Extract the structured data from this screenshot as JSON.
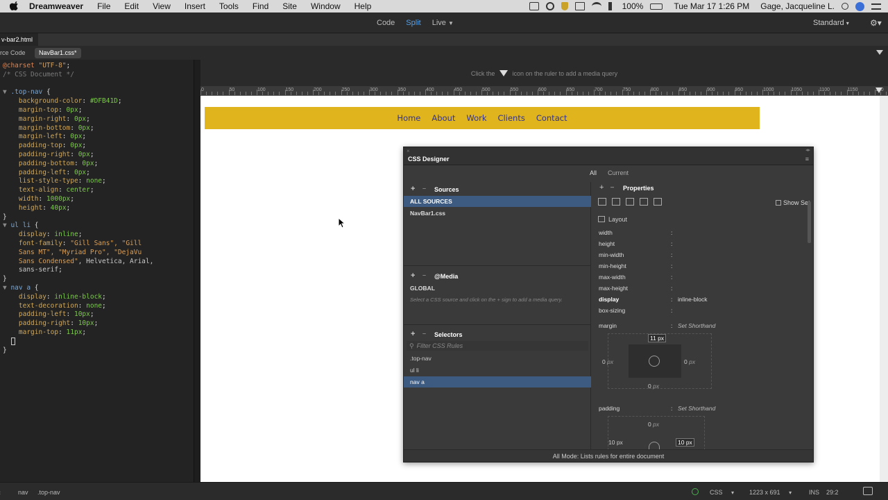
{
  "menubar": {
    "app": "Dreamweaver",
    "items": [
      "File",
      "Edit",
      "View",
      "Insert",
      "Tools",
      "Find",
      "Site",
      "Window",
      "Help"
    ],
    "battery": "100%",
    "clock": "Tue Mar 17  1:26 PM",
    "user": "Gage, Jacqueline L."
  },
  "toolbar": {
    "views": [
      "Code",
      "Split",
      "Live"
    ],
    "active_view": "Split",
    "workspace": "Standard"
  },
  "doc_tab": "v-bar2.html",
  "related_files": {
    "source": "rce Code",
    "css": "NavBar1.css*"
  },
  "code_lines": [
    [
      [
        "c-at",
        "@charset "
      ],
      [
        "c-str",
        "\"UTF-8\""
      ],
      [
        "c-plain",
        ";"
      ]
    ],
    [
      [
        "c-gray",
        "/* CSS Document */"
      ]
    ],
    [],
    [
      [
        "fold",
        "▼ "
      ],
      [
        "c-sel",
        ".top-nav "
      ],
      [
        "c-plain",
        "{"
      ]
    ],
    [
      [
        "c-prop",
        "    background-color"
      ],
      [
        "c-plain",
        ": "
      ],
      [
        "c-val",
        "#DFB41D"
      ],
      [
        "c-plain",
        ";"
      ]
    ],
    [
      [
        "c-prop",
        "    margin-top"
      ],
      [
        "c-plain",
        ": "
      ],
      [
        "c-val",
        "0px"
      ],
      [
        "c-plain",
        ";"
      ]
    ],
    [
      [
        "c-prop",
        "    margin-right"
      ],
      [
        "c-plain",
        ": "
      ],
      [
        "c-val",
        "0px"
      ],
      [
        "c-plain",
        ";"
      ]
    ],
    [
      [
        "c-prop",
        "    margin-bottom"
      ],
      [
        "c-plain",
        ": "
      ],
      [
        "c-val",
        "0px"
      ],
      [
        "c-plain",
        ";"
      ]
    ],
    [
      [
        "c-prop",
        "    margin-left"
      ],
      [
        "c-plain",
        ": "
      ],
      [
        "c-val",
        "0px"
      ],
      [
        "c-plain",
        ";"
      ]
    ],
    [
      [
        "c-prop",
        "    padding-top"
      ],
      [
        "c-plain",
        ": "
      ],
      [
        "c-val",
        "0px"
      ],
      [
        "c-plain",
        ";"
      ]
    ],
    [
      [
        "c-prop",
        "    padding-right"
      ],
      [
        "c-plain",
        ": "
      ],
      [
        "c-val",
        "0px"
      ],
      [
        "c-plain",
        ";"
      ]
    ],
    [
      [
        "c-prop",
        "    padding-bottom"
      ],
      [
        "c-plain",
        ": "
      ],
      [
        "c-val",
        "0px"
      ],
      [
        "c-plain",
        ";"
      ]
    ],
    [
      [
        "c-prop",
        "    padding-left"
      ],
      [
        "c-plain",
        ": "
      ],
      [
        "c-val",
        "0px"
      ],
      [
        "c-plain",
        ";"
      ]
    ],
    [
      [
        "c-prop",
        "    list-style-type"
      ],
      [
        "c-plain",
        ": "
      ],
      [
        "c-val",
        "none"
      ],
      [
        "c-plain",
        ";"
      ]
    ],
    [
      [
        "c-prop",
        "    text-align"
      ],
      [
        "c-plain",
        ": "
      ],
      [
        "c-val",
        "center"
      ],
      [
        "c-plain",
        ";"
      ]
    ],
    [
      [
        "c-prop",
        "    width"
      ],
      [
        "c-plain",
        ": "
      ],
      [
        "c-val",
        "1000px"
      ],
      [
        "c-plain",
        ";"
      ]
    ],
    [
      [
        "c-prop",
        "    height"
      ],
      [
        "c-plain",
        ": "
      ],
      [
        "c-val",
        "40px"
      ],
      [
        "c-plain",
        ";"
      ]
    ],
    [
      [
        "c-plain",
        "}"
      ]
    ],
    [
      [
        "fold",
        "▼ "
      ],
      [
        "c-sel",
        "ul li "
      ],
      [
        "c-plain",
        "{"
      ]
    ],
    [
      [
        "c-prop",
        "    display"
      ],
      [
        "c-plain",
        ": "
      ],
      [
        "c-val",
        "inline"
      ],
      [
        "c-plain",
        ";"
      ]
    ],
    [
      [
        "c-prop",
        "    font-family"
      ],
      [
        "c-plain",
        ": "
      ],
      [
        "c-str",
        "\"Gill Sans\", \"Gill"
      ]
    ],
    [
      [
        "c-str",
        "    Sans MT\", \"Myriad Pro\", \"DejaVu"
      ]
    ],
    [
      [
        "c-str",
        "    Sans Condensed\""
      ],
      [
        "c-txt",
        ", Helvetica, Arial,"
      ]
    ],
    [
      [
        "c-txt",
        "    sans-serif"
      ],
      [
        "c-plain",
        ";"
      ]
    ],
    [
      [
        "c-plain",
        "}"
      ]
    ],
    [
      [
        "fold",
        "▼ "
      ],
      [
        "c-sel",
        "nav a "
      ],
      [
        "c-plain",
        "{"
      ]
    ],
    [
      [
        "c-prop",
        "    display"
      ],
      [
        "c-plain",
        ": "
      ],
      [
        "c-val",
        "inline-block"
      ],
      [
        "c-plain",
        ";"
      ]
    ],
    [
      [
        "c-prop",
        "    text-decoration"
      ],
      [
        "c-plain",
        ": "
      ],
      [
        "c-val",
        "none"
      ],
      [
        "c-plain",
        ";"
      ]
    ],
    [
      [
        "c-prop",
        "    padding-left"
      ],
      [
        "c-plain",
        ": "
      ],
      [
        "c-val",
        "10px"
      ],
      [
        "c-plain",
        ";"
      ]
    ],
    [
      [
        "c-prop",
        "    padding-right"
      ],
      [
        "c-plain",
        ": "
      ],
      [
        "c-val",
        "10px"
      ],
      [
        "c-plain",
        ";"
      ]
    ],
    [
      [
        "c-prop",
        "    margin-top"
      ],
      [
        "c-plain",
        ": "
      ],
      [
        "c-val",
        "11px"
      ],
      [
        "c-plain",
        ";"
      ]
    ],
    [],
    [
      [
        "c-plain",
        "}"
      ]
    ]
  ],
  "live": {
    "media_hint_pre": "Click the",
    "media_hint_post": "icon on the ruler to add a media query",
    "ruler_ticks": [
      "0",
      "50",
      "100",
      "150",
      "200",
      "250",
      "300",
      "350",
      "400",
      "450",
      "500",
      "550",
      "600",
      "650",
      "700",
      "750",
      "800",
      "850",
      "900",
      "950",
      "1000",
      "1050",
      "1100",
      "1150",
      "120"
    ],
    "nav_links": [
      "Home",
      "About",
      "Work",
      "Clients",
      "Contact"
    ],
    "nav_color": "#DFB41D"
  },
  "css_designer": {
    "title": "CSS Designer",
    "modes": [
      "All",
      "Current"
    ],
    "sources_label": "Sources",
    "sources": [
      "ALL SOURCES",
      "NavBar1.css"
    ],
    "media_label": "@Media",
    "media_global": "GLOBAL",
    "media_hint": "Select a CSS source and click on the + sign to add a media query.",
    "selectors_label": "Selectors",
    "filter_placeholder": "Filter CSS Rules",
    "selectors": [
      ".top-nav",
      "ul li",
      "nav a"
    ],
    "properties_label": "Properties",
    "show_set": "Show Set",
    "layout_label": "Layout",
    "props": [
      {
        "name": "width",
        "value": ""
      },
      {
        "name": "height",
        "value": ""
      },
      {
        "name": "min-width",
        "value": ""
      },
      {
        "name": "min-height",
        "value": ""
      },
      {
        "name": "max-width",
        "value": ""
      },
      {
        "name": "max-height",
        "value": ""
      },
      {
        "name": "display",
        "value": "inline-block"
      },
      {
        "name": "box-sizing",
        "value": ""
      }
    ],
    "margin_label": "margin",
    "padding_label": "padding",
    "set_shorthand": "Set Shorthand",
    "margin": {
      "top": "11 px",
      "left": "0",
      "right": "0",
      "bottom": "0"
    },
    "padding": {
      "top": "0",
      "left": "10 px",
      "right": "10 px"
    },
    "unit": "px",
    "footer": "All Mode: Lists rules for entire document"
  },
  "statusbar": {
    "tags": [
      "nav",
      ".top-nav"
    ],
    "lang": "CSS",
    "size": "1223 x 691",
    "mode": "INS",
    "pos": "29:2"
  }
}
